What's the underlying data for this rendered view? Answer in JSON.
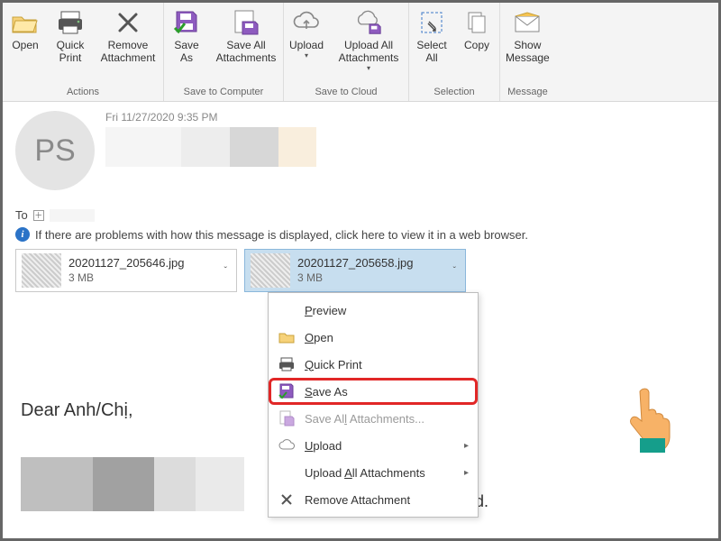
{
  "ribbon": {
    "groups": [
      {
        "label": "Actions",
        "buttons": [
          "Open",
          "Quick\nPrint",
          "Remove\nAttachment"
        ]
      },
      {
        "label": "Save to Computer",
        "buttons": [
          "Save\nAs",
          "Save All\nAttachments"
        ]
      },
      {
        "label": "Save to Cloud",
        "buttons": [
          "Upload",
          "Upload All\nAttachments"
        ]
      },
      {
        "label": "Selection",
        "buttons": [
          "Select\nAll",
          "Copy"
        ]
      },
      {
        "label": "Message",
        "buttons": [
          "Show\nMessage"
        ]
      }
    ]
  },
  "header": {
    "avatar_initials": "PS",
    "timestamp": "Fri 11/27/2020 9:35 PM",
    "to_label": "To",
    "info_text": "If there are problems with how this message is displayed, click here to view it in a web browser."
  },
  "attachments": [
    {
      "name": "20201127_205646.jpg",
      "size": "3 MB",
      "selected": false
    },
    {
      "name": "20201127_205658.jpg",
      "size": "3 MB",
      "selected": true
    }
  ],
  "context_menu": {
    "items": [
      {
        "label": "Preview",
        "mn": "P",
        "icon": "",
        "disabled": false,
        "submenu": false
      },
      {
        "label": "Open",
        "mn": "O",
        "icon": "folder",
        "disabled": false,
        "submenu": false
      },
      {
        "label": "Quick Print",
        "mn": "Q",
        "icon": "printer",
        "disabled": false,
        "submenu": false
      },
      {
        "label": "Save As",
        "mn": "S",
        "icon": "save-check",
        "disabled": false,
        "submenu": false,
        "highlight": true
      },
      {
        "label": "Save All Attachments...",
        "mn": "",
        "icon": "save-all",
        "disabled": true,
        "submenu": false
      },
      {
        "label": "Upload",
        "mn": "U",
        "icon": "cloud",
        "disabled": false,
        "submenu": true
      },
      {
        "label": "Upload All Attachments",
        "mn": "A",
        "icon": "",
        "disabled": false,
        "submenu": true
      },
      {
        "label": "Remove Attachment",
        "mn": "",
        "icon": "x",
        "disabled": false,
        "submenu": false
      }
    ]
  },
  "body": {
    "greeting": "Dear Anh/Chị,",
    "tail": "d."
  }
}
